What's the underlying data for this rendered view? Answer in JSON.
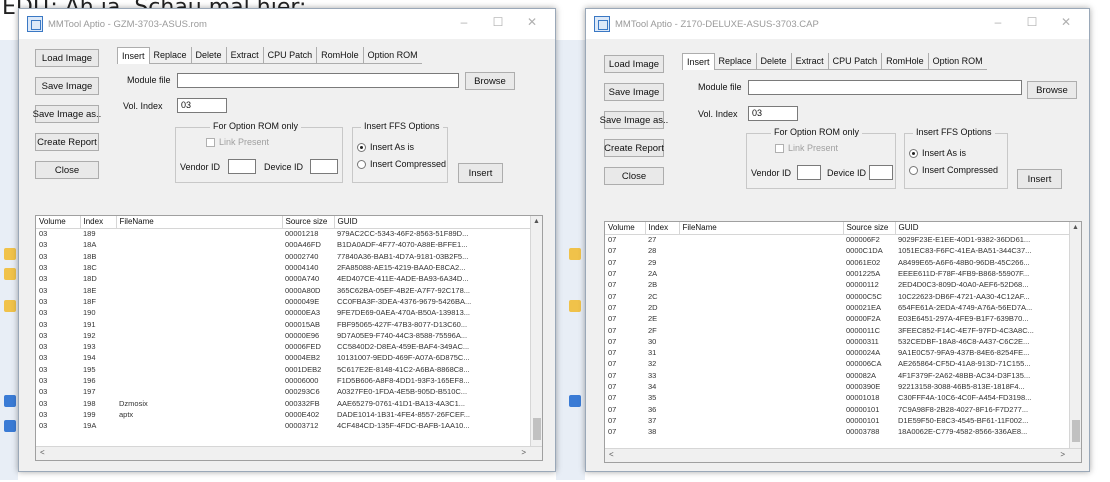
{
  "caption": "EDIT: Ah ja. Schau mal hier:",
  "window_buttons": {
    "minimize": "–",
    "maximize": "☐",
    "close": "✕"
  },
  "windows": [
    {
      "title": "MMTool Aptio - GZM-3703-ASUS.rom",
      "buttons": {
        "load": "Load Image",
        "save": "Save Image",
        "save_as": "Save Image as..",
        "report": "Create Report",
        "close": "Close"
      },
      "tabs": [
        "Insert",
        "Replace",
        "Delete",
        "Extract",
        "CPU Patch",
        "RomHole",
        "Option ROM"
      ],
      "module_file_label": "Module file",
      "module_file_value": "",
      "browse": "Browse",
      "vol_index_label": "Vol. Index",
      "vol_index_value": "03",
      "option_rom_group": "For Option ROM only",
      "link_present": "Link Present",
      "vendor_id": "Vendor ID",
      "device_id": "Device ID",
      "ffs_group": "Insert FFS Options",
      "insert_as_is": "Insert As is",
      "insert_compressed": "Insert Compressed",
      "insert_button": "Insert",
      "columns": [
        "Volume",
        "Index",
        "FileName",
        "Source size",
        "GUID"
      ],
      "rows": [
        [
          "03",
          "189",
          "",
          "00001218",
          "979AC2CC-5343-46F2-8563-51F89D..."
        ],
        [
          "03",
          "18A",
          "",
          "000A46FD",
          "B1DA0ADF-4F77-4070-A88E-BFFE1..."
        ],
        [
          "03",
          "18B",
          "",
          "00002740",
          "77840A36-BAB1-4D7A-9181-03B2F5..."
        ],
        [
          "03",
          "18C",
          "",
          "00004140",
          "2FA85088-AE15-4219-BAA0-E8CA2..."
        ],
        [
          "03",
          "18D",
          "",
          "0000A740",
          "4ED407CE-411E-4ADE-BA93-6A34D..."
        ],
        [
          "03",
          "18E",
          "",
          "0000A80D",
          "365C62BA-05EF-4B2E-A7F7-92C178..."
        ],
        [
          "03",
          "18F",
          "",
          "0000049E",
          "CC0FBA3F-3DEA-4376-9679-5426BA..."
        ],
        [
          "03",
          "190",
          "",
          "00000EA3",
          "9FE7DE69-0AEA-470A-B50A-139813..."
        ],
        [
          "03",
          "191",
          "",
          "000015AB",
          "FBF95065-427F-47B3-8077-D13C60..."
        ],
        [
          "03",
          "192",
          "",
          "00000E96",
          "9D7A05E9-F740-44C3-8588-75596A..."
        ],
        [
          "03",
          "193",
          "",
          "00006FED",
          "CC5840D2-D8EA-459E-BAF4-349AC..."
        ],
        [
          "03",
          "194",
          "",
          "00004EB2",
          "10131007-9EDD-469F-A07A-6D875C..."
        ],
        [
          "03",
          "195",
          "",
          "0001DEB2",
          "5C617E2E-8148-41C2-A6BA-8868C8..."
        ],
        [
          "03",
          "196",
          "",
          "00006000",
          "F1D5B606-A8F8-4DD1-93F3-165EF8..."
        ],
        [
          "03",
          "197",
          "",
          "000293C6",
          "A0327FE0-1FDA-4E5B-905D-B510C..."
        ],
        [
          "03",
          "198",
          "Dzmosix",
          "000332FB",
          "AAE65279-0761-41D1-BA13-4A3C1..."
        ],
        [
          "03",
          "199",
          "aptx",
          "0000E402",
          "DADE1014-1B31-4FE4-8557-26FCEF..."
        ],
        [
          "03",
          "19A",
          "",
          "00003712",
          "4CF484CD-135F-4FDC-BAFB-1AA10..."
        ]
      ]
    },
    {
      "title": "MMTool Aptio - Z170-DELUXE-ASUS-3703.CAP",
      "buttons": {
        "load": "Load Image",
        "save": "Save Image",
        "save_as": "Save Image as..",
        "report": "Create Report",
        "close": "Close"
      },
      "tabs": [
        "Insert",
        "Replace",
        "Delete",
        "Extract",
        "CPU Patch",
        "RomHole",
        "Option ROM"
      ],
      "module_file_label": "Module file",
      "module_file_value": "",
      "browse": "Browse",
      "vol_index_label": "Vol. Index",
      "vol_index_value": "03",
      "option_rom_group": "For Option ROM only",
      "link_present": "Link Present",
      "vendor_id": "Vendor ID",
      "device_id": "Device ID",
      "ffs_group": "Insert FFS Options",
      "insert_as_is": "Insert As is",
      "insert_compressed": "Insert Compressed",
      "insert_button": "Insert",
      "columns": [
        "Volume",
        "Index",
        "FileName",
        "Source size",
        "GUID"
      ],
      "rows": [
        [
          "07",
          "27",
          "",
          "000006F2",
          "9029F23E-E1EE-40D1-9382-36DD61..."
        ],
        [
          "07",
          "28",
          "",
          "0000C1DA",
          "1051EC83-F6FC-41EA-BA51-344C37..."
        ],
        [
          "07",
          "29",
          "",
          "00061E02",
          "A8499E65-A6F6-48B0-96DB-45C266..."
        ],
        [
          "07",
          "2A",
          "",
          "0001225A",
          "EEEE611D-F78F-4FB9-B868-55907F..."
        ],
        [
          "07",
          "2B",
          "",
          "00000112",
          "2ED4D0C3-809D-40A0-AEF6-52D68..."
        ],
        [
          "07",
          "2C",
          "",
          "00000C5C",
          "10C22623-DB6F-4721-AA30-4C12AF..."
        ],
        [
          "07",
          "2D",
          "",
          "000021EA",
          "654FE61A-2EDA-4749-A76A-56ED7A..."
        ],
        [
          "07",
          "2E",
          "",
          "00000F2A",
          "E03E6451-297A-4FE9-B1F7-639B70..."
        ],
        [
          "07",
          "2F",
          "",
          "0000011C",
          "3FEEC852-F14C-4E7F-97FD-4C3A8C..."
        ],
        [
          "07",
          "30",
          "",
          "00000311",
          "532CEDBF-18A8-46C8-A437-C6C2E..."
        ],
        [
          "07",
          "31",
          "",
          "0000024A",
          "9A1E0C57-9FA9-437B-84E6-8254FE..."
        ],
        [
          "07",
          "32",
          "",
          "000006CA",
          "AE265864-CF5D-41A8-913D-71C155..."
        ],
        [
          "07",
          "33",
          "",
          "000082A",
          "4F1F379F-2A62-48BB-AC34-D3F135..."
        ],
        [
          "07",
          "34",
          "",
          "0000390E",
          "92213158-3088-46B5-813E-1818F4..."
        ],
        [
          "07",
          "35",
          "",
          "00001018",
          "C30FFF4A-10C6-4C0F-A454-FD3198..."
        ],
        [
          "07",
          "36",
          "",
          "00000101",
          "7C9A98F8-2B28-4027-8F16-F7D277..."
        ],
        [
          "07",
          "37",
          "",
          "00000101",
          "D1E59F50-E8C3-4545-BF61-11F002..."
        ],
        [
          "07",
          "38",
          "",
          "00003788",
          "18A0062E-C779-4582-8566-336AE8..."
        ]
      ]
    }
  ]
}
